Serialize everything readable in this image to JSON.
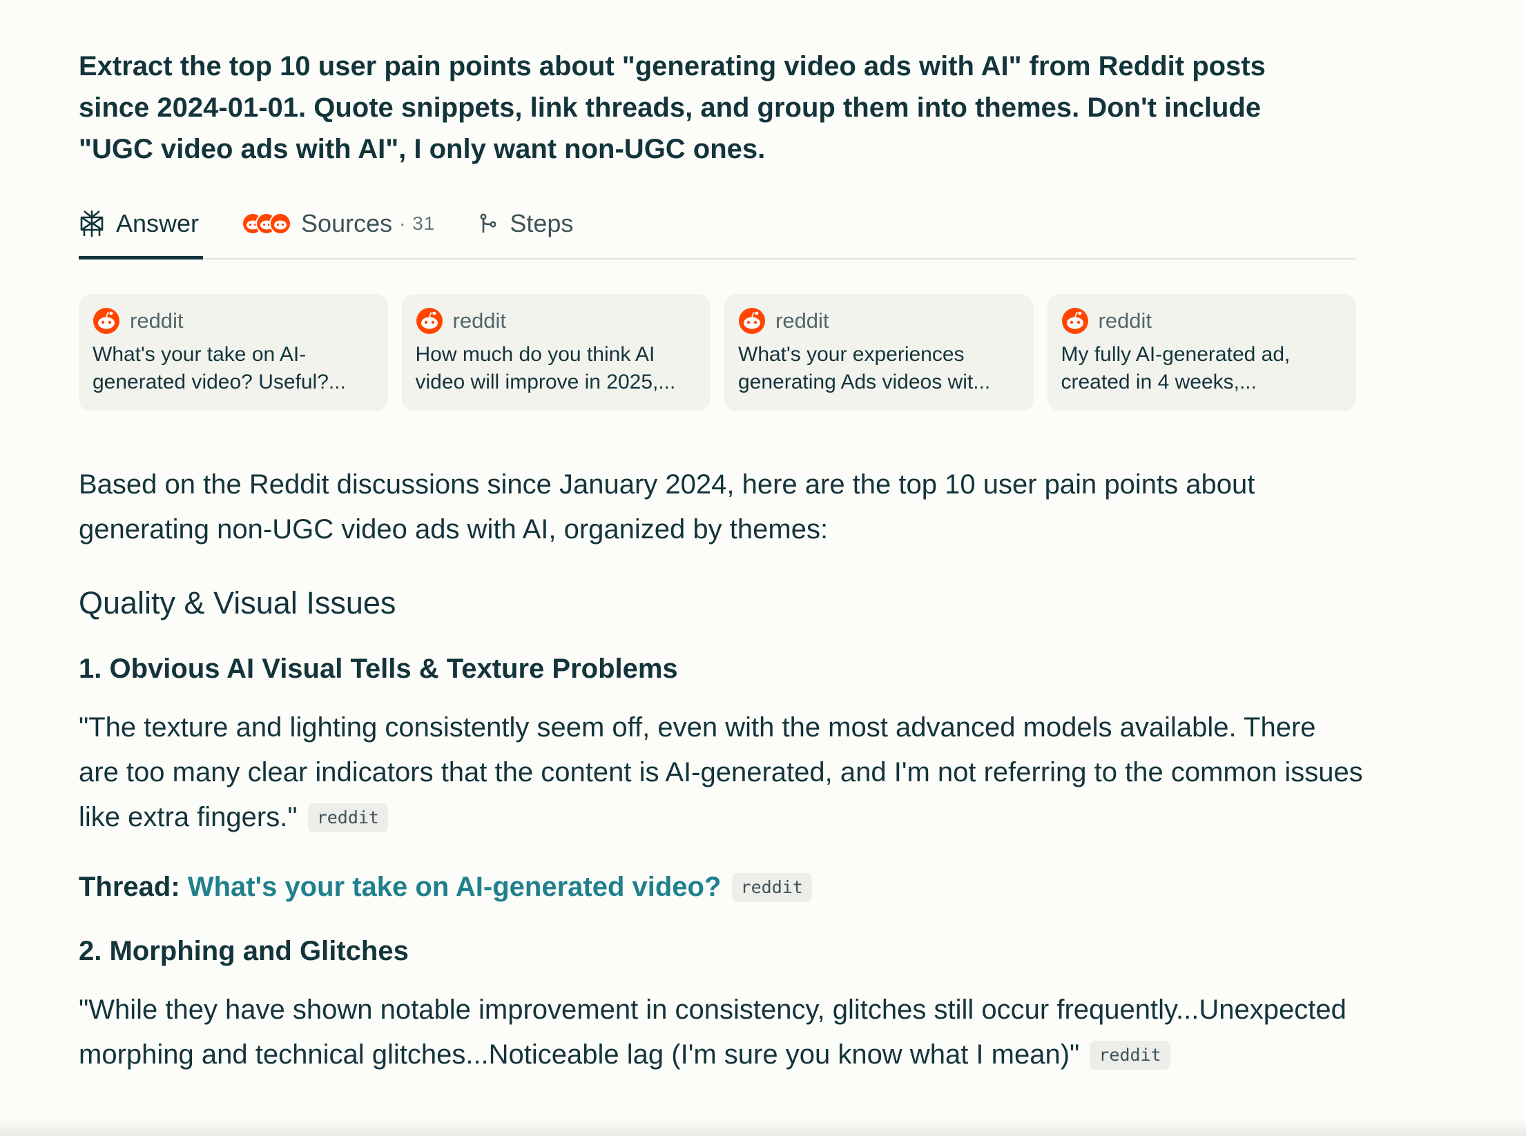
{
  "query": "Extract the top 10 user pain points about \"generating video ads with AI\" from Reddit posts since 2024-01-01. Quote snippets, link threads, and group them into themes. Don't include \"UGC video ads with AI\", I only want non-UGC ones.",
  "tabs": {
    "answer_label": "Answer",
    "sources_label": "Sources",
    "sources_count": "· 31",
    "steps_label": "Steps"
  },
  "source_cards": [
    {
      "source": "reddit",
      "title": "What's your take on AI-generated video? Useful?..."
    },
    {
      "source": "reddit",
      "title": "How much do you think AI video will improve in 2025,..."
    },
    {
      "source": "reddit",
      "title": "What's your experiences generating Ads videos wit..."
    },
    {
      "source": "reddit",
      "title": "My fully AI-generated ad, created in 4 weeks,..."
    }
  ],
  "answer": {
    "intro": "Based on the Reddit discussions since January 2024, here are the top 10 user pain points about generating non-UGC video ads with AI, organized by themes:",
    "theme_1": "Quality & Visual Issues",
    "point_1": {
      "heading": "1. Obvious AI Visual Tells & Texture Problems",
      "quote": "\"The texture and lighting consistently seem off, even with the most advanced models available. There are too many clear indicators that the content is AI-generated, and I'm not referring to the common issues like extra fingers.\"",
      "citation": "reddit",
      "thread_prefix": "Thread:",
      "thread_link": "What's your take on AI-generated video?",
      "thread_citation": "reddit"
    },
    "point_2": {
      "heading": "2. Morphing and Glitches",
      "quote": "\"While they have shown notable improvement in consistency, glitches still occur frequently...Unexpected morphing and technical glitches...Noticeable lag (I'm sure you know what I mean)\"",
      "citation": "reddit"
    }
  },
  "colors": {
    "background": "#fcfcf9",
    "text": "#13343b",
    "link": "#20808d",
    "card_bg": "#f3f3ee",
    "reddit_orange": "#ff4500"
  },
  "icons": {
    "answer": "perplexity-logo-icon",
    "sources": "reddit-avatar-stack",
    "steps": "branch-steps-icon",
    "card_source": "reddit-logo-icon"
  }
}
